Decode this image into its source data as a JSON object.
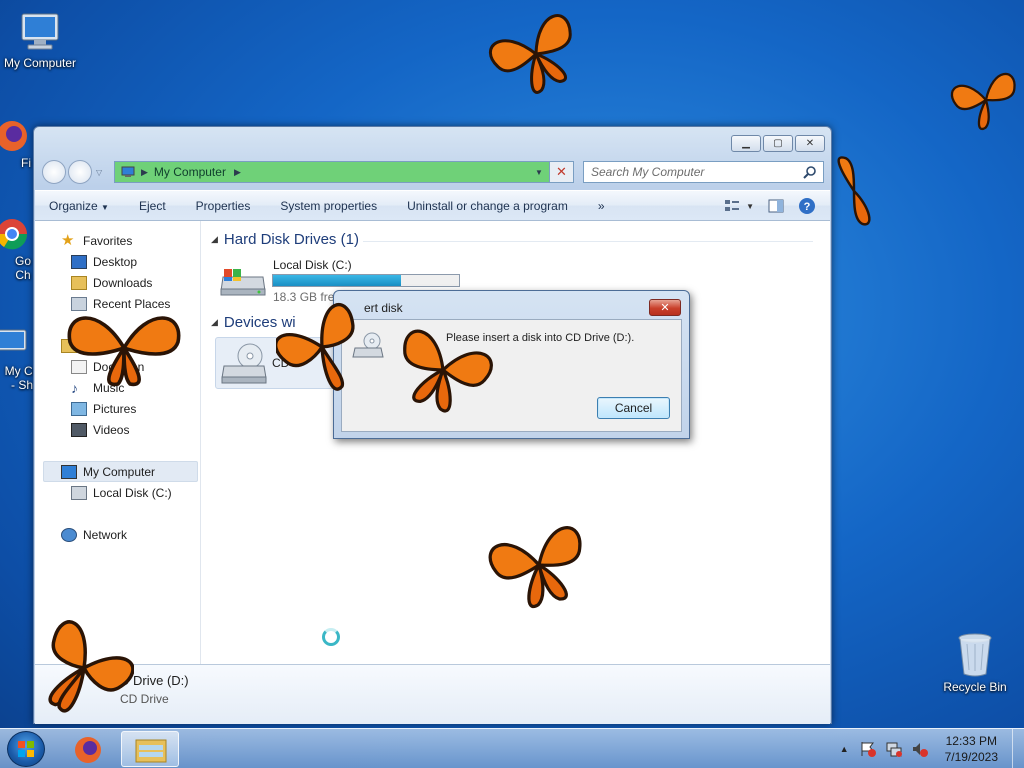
{
  "desktop": {
    "icons": [
      {
        "label": "My Computer"
      },
      {
        "label": "Fi"
      },
      {
        "label": "Go Ch"
      },
      {
        "label": "My Co - Sh"
      },
      {
        "label": "Recycle Bin"
      }
    ]
  },
  "window": {
    "address": {
      "crumb": "My Computer"
    },
    "search": {
      "placeholder": "Search My Computer"
    },
    "toolbar": {
      "organize": "Organize",
      "eject": "Eject",
      "properties": "Properties",
      "system_properties": "System properties",
      "uninstall": "Uninstall or change a program",
      "more": "»"
    },
    "nav_pane": {
      "favorites": "Favorites",
      "desktop": "Desktop",
      "downloads": "Downloads",
      "recent_places": "Recent Places",
      "documents": "Documen",
      "music": "Music",
      "pictures": "Pictures",
      "videos": "Videos",
      "my_computer": "My Computer",
      "local_disk": "Local Disk (C:)",
      "network": "Network"
    },
    "main": {
      "hdd_group": "Hard Disk Drives (1)",
      "local_disk_name": "Local Disk (C:)",
      "local_disk_free": "18.3 GB free",
      "local_disk_used_fraction": 0.69,
      "devices_group": "Devices wi",
      "cd_label": "CD D"
    },
    "details": {
      "title": "D Drive (D:)",
      "subtitle": "CD Drive"
    }
  },
  "dialog": {
    "title": "ert disk",
    "message": "Please insert a disk into CD Drive (D:).",
    "cancel": "Cancel",
    "close": "✕"
  },
  "taskbar": {
    "clock_time": "12:33 PM",
    "clock_date": "7/19/2023"
  },
  "colors": {
    "desktop_blue": "#1466c6",
    "address_green": "#6fd178",
    "progress": "#1a8fc4",
    "butterfly_orange": "#f07a12"
  }
}
